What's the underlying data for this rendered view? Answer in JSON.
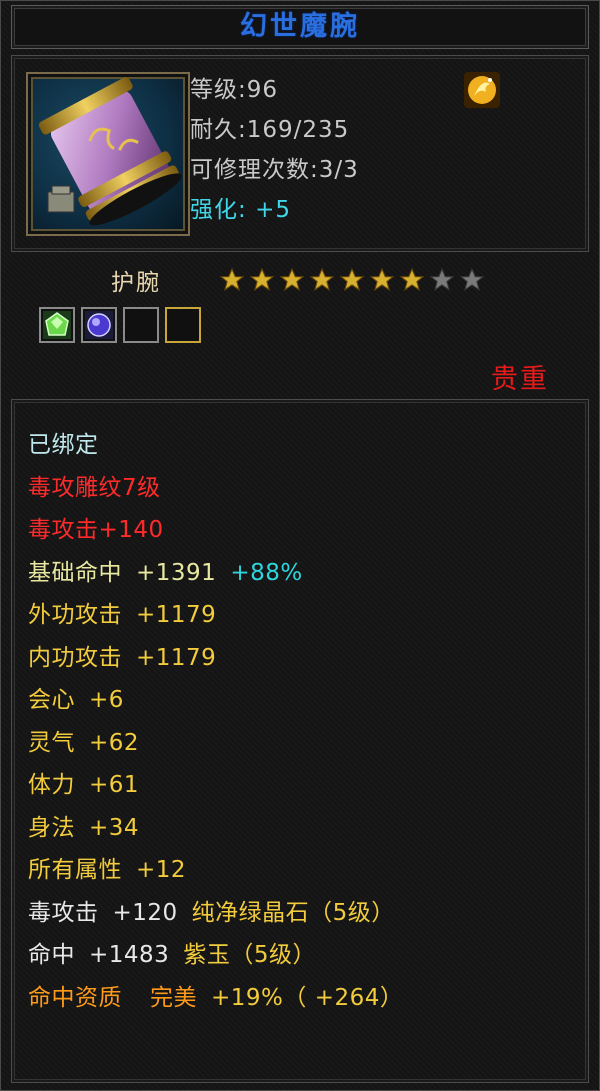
{
  "item": {
    "name": "幻世魔腕",
    "level": "等级:96",
    "durability": "耐久:169/235",
    "repairs": "可修理次数:3/3",
    "enhance_label": "强化:",
    "enhance_value": "+5",
    "type": "护腕",
    "stars_total": 9,
    "stars_filled": 7,
    "rarity": "贵重"
  },
  "sockets": [
    {
      "gem": "green-gem"
    },
    {
      "gem": "purple-gem"
    },
    {
      "gem": "empty"
    },
    {
      "gem": "empty-gold"
    }
  ],
  "attributes": {
    "bound": "已绑定",
    "engrave": "毒攻雕纹7级",
    "poison_attack": "毒攻击+140",
    "base_hit_label": "基础命中",
    "base_hit_value": "+1391",
    "base_hit_pct": "+88%",
    "ext_atk_label": "外功攻击",
    "ext_atk_value": "+1179",
    "int_atk_label": "内功攻击",
    "int_atk_value": "+1179",
    "crit_label": "会心",
    "crit_value": "+6",
    "spirit_label": "灵气",
    "spirit_value": "+62",
    "stamina_label": "体力",
    "stamina_value": "+61",
    "agility_label": "身法",
    "agility_value": "+34",
    "all_attr_label": "所有属性",
    "all_attr_value": "+12",
    "gem1_label": "毒攻击",
    "gem1_value": "+120",
    "gem1_name": "纯净绿晶石（5级）",
    "gem2_label": "命中",
    "gem2_value": "+1483",
    "gem2_name": "紫玉（5级）",
    "quality_label": "命中资质",
    "quality_grade": "完美",
    "quality_pct": "+19%",
    "quality_bonus": "（ +264）"
  },
  "colors": {
    "title": "#2a6fe0",
    "enhance": "#3fd6e8",
    "rarity": "#e51b1b",
    "red_attr": "#ff2a2a",
    "yellow_attr": "#f2cc3c",
    "orange_attr": "#ff9a1a",
    "star_gold": "#d8b030",
    "star_gray": "#7a7a7a"
  }
}
